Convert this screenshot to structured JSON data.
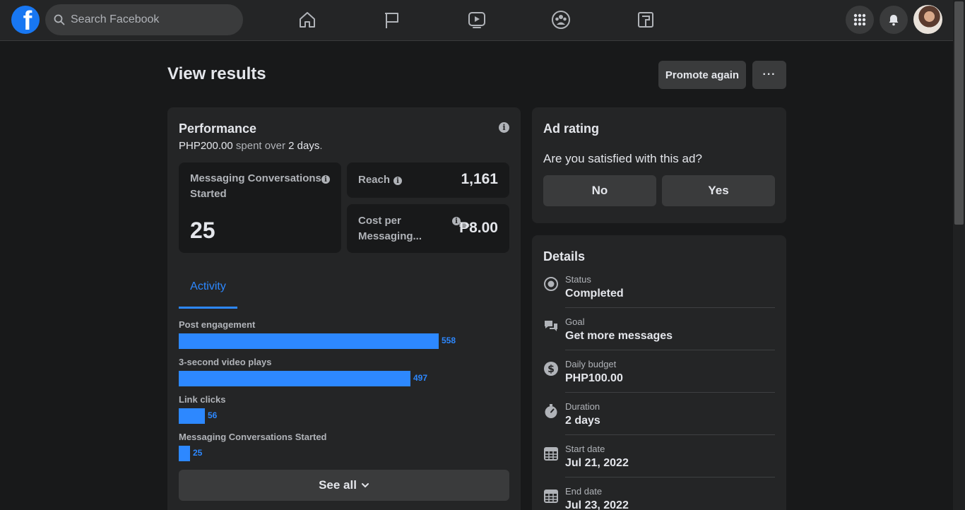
{
  "topbar": {
    "logo": "f",
    "search_placeholder": "Search Facebook",
    "nav_icons": [
      "home-icon",
      "pages-flag-icon",
      "watch-video-icon",
      "groups-icon",
      "gaming-icon"
    ],
    "right_icons": [
      "menu-grid-icon",
      "notifications-bell-icon"
    ]
  },
  "header": {
    "title": "View results",
    "promote_label": "Promote again",
    "more_label": "···"
  },
  "performance": {
    "title": "Performance",
    "spent_amount": "PHP200.00",
    "spent_middle": " spent over ",
    "spent_days": "2 days",
    "spent_end": ".",
    "metrics": {
      "messaging": {
        "label": "Messaging Conversations Started",
        "value": "25"
      },
      "reach": {
        "label": "Reach",
        "value": "1,161"
      },
      "cost": {
        "label": "Cost per Messaging...",
        "value": "₱8.00"
      }
    },
    "tab_label": "Activity",
    "see_all_label": "See all"
  },
  "chart_data": {
    "type": "bar",
    "orientation": "horizontal",
    "categories": [
      "Post engagement",
      "3-second video plays",
      "Link clicks",
      "Messaging Conversations Started"
    ],
    "values": [
      558,
      497,
      56,
      25
    ]
  },
  "ad_rating": {
    "title": "Ad rating",
    "question": "Are you satisfied with this ad?",
    "no_label": "No",
    "yes_label": "Yes"
  },
  "details": {
    "title": "Details",
    "rows": [
      {
        "key": "Status",
        "value": "Completed",
        "icon": "status-radio-icon"
      },
      {
        "key": "Goal",
        "value": "Get more messages",
        "icon": "chat-bubbles-icon"
      },
      {
        "key": "Daily budget",
        "value": "PHP100.00",
        "icon": "dollar-icon"
      },
      {
        "key": "Duration",
        "value": "2 days",
        "icon": "stopwatch-icon"
      },
      {
        "key": "Start date",
        "value": "Jul 21, 2022",
        "icon": "calendar-icon"
      },
      {
        "key": "End date",
        "value": "Jul 23, 2022",
        "icon": "calendar-icon"
      }
    ]
  },
  "colors": {
    "accent": "#2d88ff",
    "background": "#18191a",
    "card": "#242526",
    "button": "#3a3b3c"
  }
}
